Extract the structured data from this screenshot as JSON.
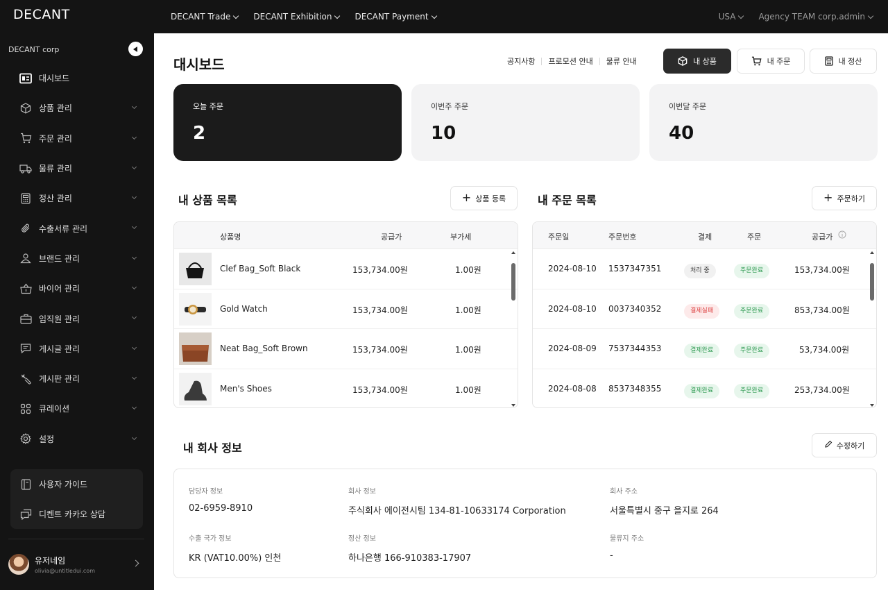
{
  "top_nav": {
    "logo": "DECANT",
    "items": [
      "DECANT Trade",
      "DECANT Exhibition",
      "DECANT Payment"
    ],
    "region": "USA",
    "account": "Agency TEAM corp.admin"
  },
  "sidebar": {
    "org": "DECANT corp",
    "items": [
      {
        "label": "대시보드",
        "icon": "dashboard-icon"
      },
      {
        "label": "상품 관리",
        "icon": "cube-icon"
      },
      {
        "label": "주문 관리",
        "icon": "cart-icon"
      },
      {
        "label": "물류 관리",
        "icon": "truck-icon"
      },
      {
        "label": "정산 관리",
        "icon": "calculator-icon"
      },
      {
        "label": "수출서류 관리",
        "icon": "paperclip-icon"
      },
      {
        "label": "브랜드 관리",
        "icon": "brand-icon"
      },
      {
        "label": "바이어 관리",
        "icon": "basket-icon"
      },
      {
        "label": "임직원 관리",
        "icon": "briefcase-icon"
      },
      {
        "label": "게시글 관리",
        "icon": "message-icon"
      },
      {
        "label": "게시판 관리",
        "icon": "tools-icon"
      },
      {
        "label": "큐레이션",
        "icon": "grid-icon"
      },
      {
        "label": "설정",
        "icon": "gear-icon"
      }
    ],
    "guide": [
      "사용자 가이드",
      "디켄트 카카오 상담"
    ],
    "user": {
      "name": "유저네임",
      "email": "olivia@untitledui.com"
    }
  },
  "header": {
    "title": "대시보드",
    "links": [
      "공지사항",
      "프로모션 안내",
      "물류 안내"
    ],
    "buttons": {
      "my_products": "내 상품",
      "my_orders": "내 주문",
      "my_settlement": "내 정산"
    }
  },
  "stats": [
    {
      "label": "오늘 주문",
      "value": "2"
    },
    {
      "label": "이번주 주문",
      "value": "10"
    },
    {
      "label": "이번달 주문",
      "value": "40"
    }
  ],
  "products": {
    "title": "내 상품 목록",
    "add_button": "상품 등록",
    "columns": [
      "상품명",
      "공급가",
      "부가세"
    ],
    "rows": [
      {
        "name": "Clef Bag_Soft Black",
        "price": "153,734.00원",
        "vat": "1.00원"
      },
      {
        "name": "Gold Watch",
        "price": "153,734.00원",
        "vat": "1.00원"
      },
      {
        "name": "Neat Bag_Soft Brown",
        "price": "153,734.00원",
        "vat": "1.00원"
      },
      {
        "name": "Men's Shoes",
        "price": "153,734.00원",
        "vat": "1.00원"
      }
    ]
  },
  "orders": {
    "title": "내 주문 목록",
    "add_button": "주문하기",
    "columns": [
      "주문일",
      "주문번호",
      "결제",
      "주문",
      "공급가"
    ],
    "rows": [
      {
        "date": "2024-08-10",
        "number": "1537347351",
        "payment": "처리 중",
        "status": "주문완료",
        "price": "153,734.00원"
      },
      {
        "date": "2024-08-10",
        "number": "0037340352",
        "payment": "결제실패",
        "status": "주문완료",
        "price": "853,734.00원"
      },
      {
        "date": "2024-08-09",
        "number": "7537344353",
        "payment": "결제완료",
        "status": "주문완료",
        "price": "53,734.00원"
      },
      {
        "date": "2024-08-08",
        "number": "8537348355",
        "payment": "결제완료",
        "status": "주문완료",
        "price": "253,734.00원"
      }
    ]
  },
  "company": {
    "title": "내 회사 정보",
    "edit_button": "수정하기",
    "fields": [
      {
        "label": "담당자 정보",
        "value": "02-6959-8910"
      },
      {
        "label": "회사 정보",
        "value": "주식회사 에이전시팀 134-81-10633174 Corporation"
      },
      {
        "label": "회사 주소",
        "value": "서울특별시 중구 을지로 264"
      },
      {
        "label": "수출 국가 정보",
        "value": "KR (VAT10.00%) 인천"
      },
      {
        "label": "정산 정보",
        "value": "하나은행 166-910383-17907"
      },
      {
        "label": "물류지 주소",
        "value": "-"
      }
    ]
  }
}
